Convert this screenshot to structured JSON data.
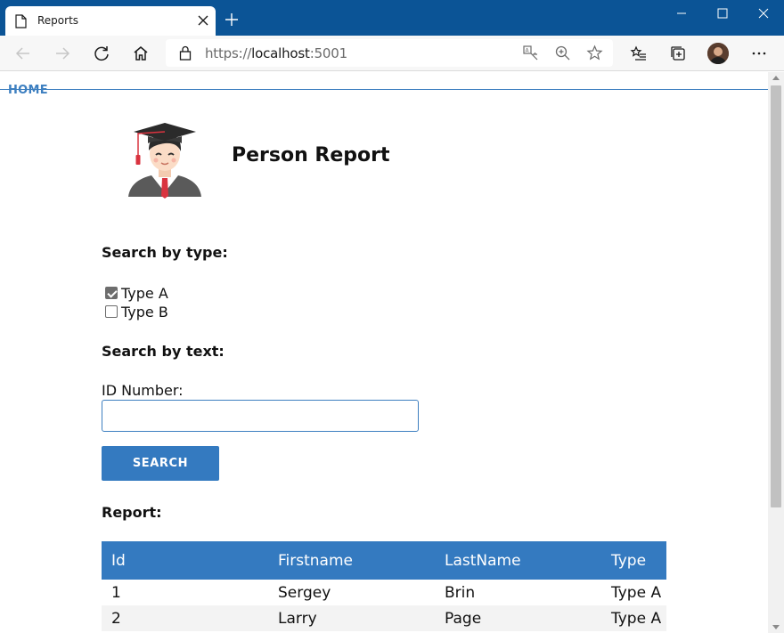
{
  "browser": {
    "tab_title": "Reports",
    "url_prefix": "https://",
    "url_host": "localhost",
    "url_port": ":5001"
  },
  "nav": {
    "home_label": "HOME"
  },
  "page": {
    "title": "Person Report",
    "search_by_type_label": "Search by type:",
    "type_options": [
      {
        "label": "Type A",
        "checked": true
      },
      {
        "label": "Type B",
        "checked": false
      }
    ],
    "search_by_text_label": "Search by text:",
    "id_field_label": "ID Number:",
    "id_field_value": "",
    "search_button_label": "SEARCH",
    "report_label": "Report:"
  },
  "table": {
    "headers": [
      "Id",
      "Firstname",
      "LastName",
      "Type"
    ],
    "rows": [
      [
        "1",
        "Sergey",
        "Brin",
        "Type A"
      ],
      [
        "2",
        "Larry",
        "Page",
        "Type A"
      ]
    ]
  },
  "colors": {
    "titlebar": "#0b5496",
    "accent": "#347ac0",
    "nav_link": "#3d7fc0"
  }
}
